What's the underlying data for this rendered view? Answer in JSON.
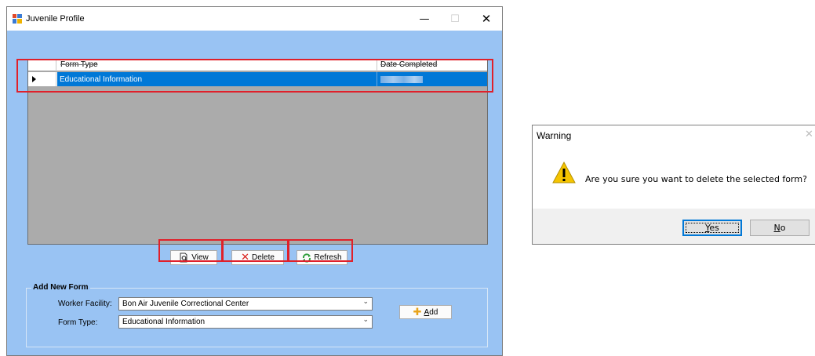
{
  "window": {
    "title": "Juvenile Profile",
    "minimize_glyph": "—",
    "maximize_glyph": "☐",
    "close_glyph": "✕"
  },
  "grid": {
    "columns": [
      "Form Type",
      "Date Completed"
    ],
    "rows": [
      {
        "form_type": "Educational Information",
        "date_completed": ""
      }
    ]
  },
  "actions": {
    "view_prefix": "",
    "view_mnemonic": "V",
    "view_rest": "iew",
    "delete_mnemonic": "D",
    "delete_rest": "elete",
    "refresh_prefix": "Re",
    "refresh_mnemonic": "f",
    "refresh_rest": "resh",
    "delete_icon": "✕"
  },
  "add_form": {
    "group_title": "Add New Form",
    "worker_facility_label": "Worker Facility:",
    "worker_facility_value": "Bon Air Juvenile Correctional Center",
    "form_type_label": "Form Type:",
    "form_type_value": "Educational Information",
    "chevron": "⌄",
    "add_mnemonic": "A",
    "add_rest": "dd",
    "add_icon": "✚"
  },
  "warning_dialog": {
    "title": "Warning",
    "close_glyph": "✕",
    "message": "Are you sure you want to delete the selected form?",
    "yes_mnemonic": "Y",
    "yes_rest": "es",
    "no_mnemonic": "N",
    "no_rest": "o"
  },
  "colors": {
    "client_bg": "#99c3f3",
    "grid_bg": "#ababab",
    "selection": "#0078d7",
    "highlight_red": "#e0202a",
    "warning_yellow": "#f5c400"
  }
}
